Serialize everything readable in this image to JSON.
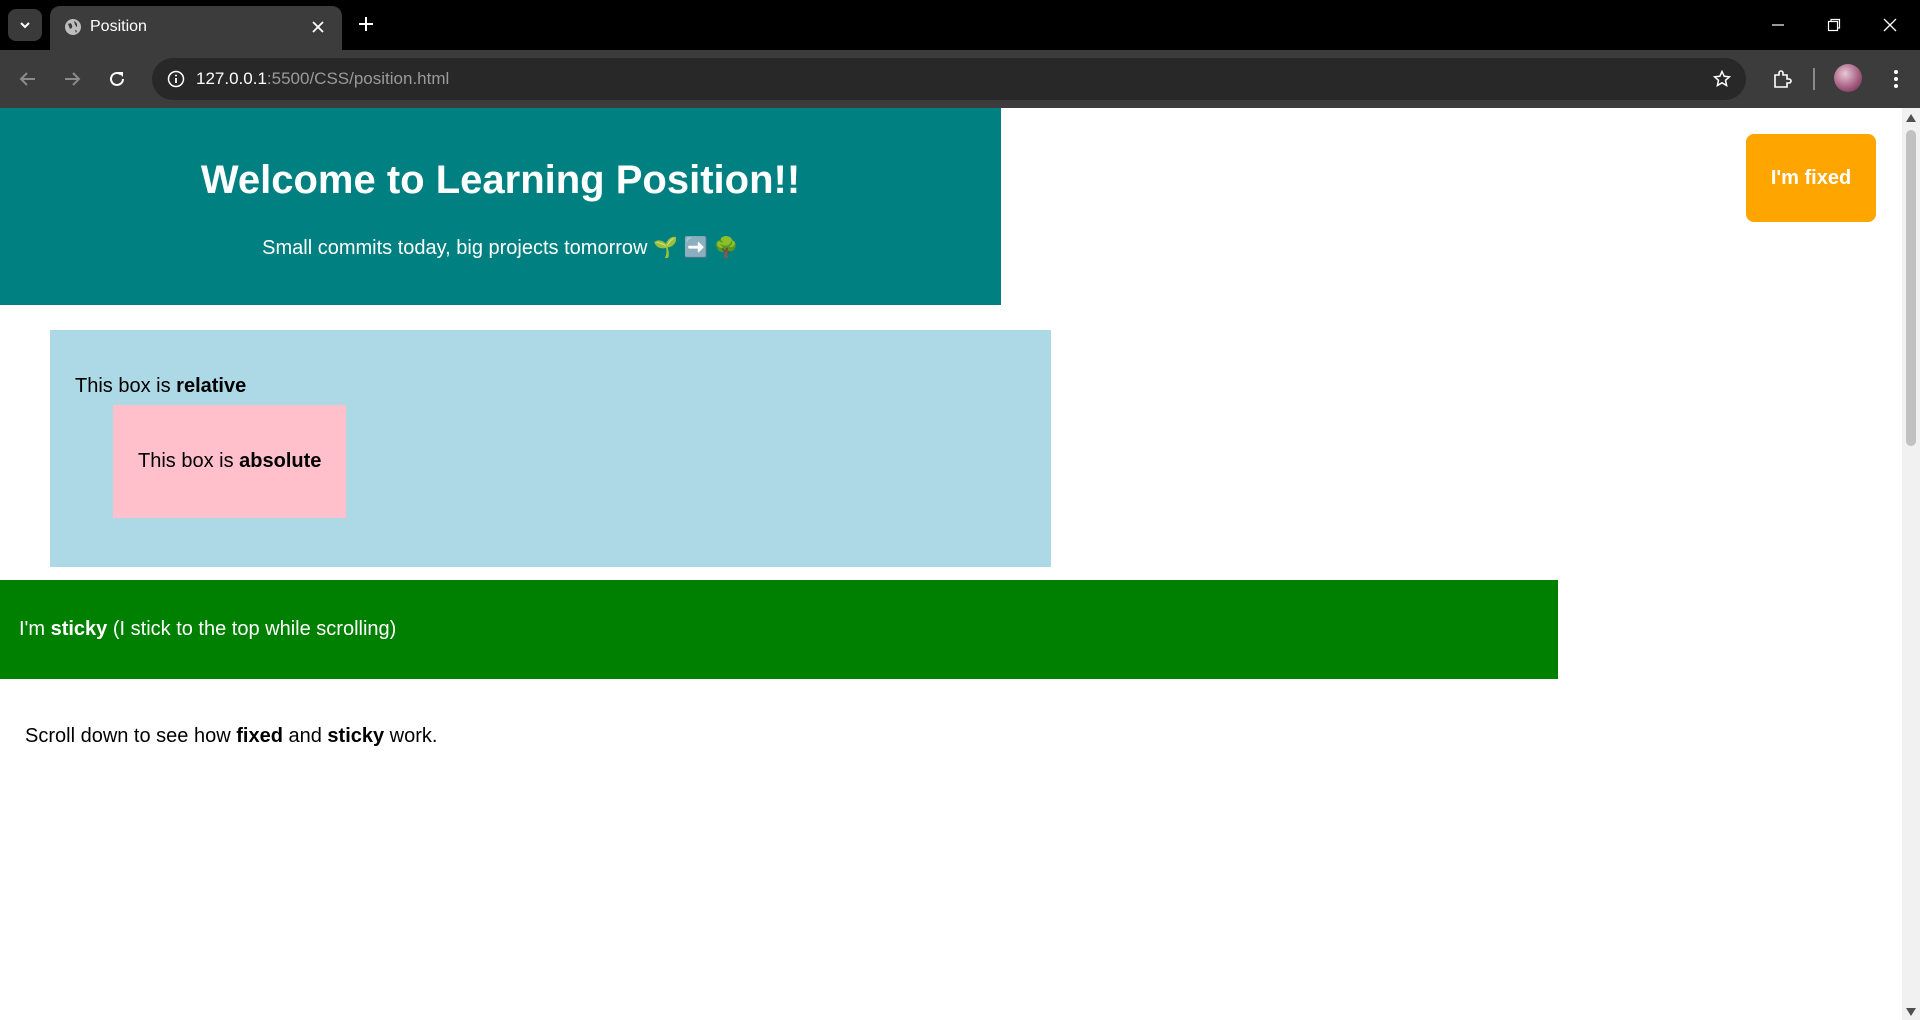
{
  "browser": {
    "tab_title": "Position",
    "url_host": "127.0.0.1",
    "url_rest": ":5500/CSS/position.html"
  },
  "page": {
    "hero": {
      "title": "Welcome to Learning Position!!",
      "subtitle": "Small commits today, big projects tomorrow 🌱 ➡️ 🌳"
    },
    "relative_box": {
      "prefix": "This box is ",
      "bold": "relative"
    },
    "absolute_box": {
      "prefix": "This box is ",
      "bold": "absolute"
    },
    "sticky": {
      "prefix": "I'm ",
      "bold": "sticky",
      "suffix": " (I stick to the top while scrolling)"
    },
    "note": {
      "part1": "Scroll down to see how ",
      "bold1": "fixed",
      "part2": " and ",
      "bold2": "sticky",
      "part3": " work."
    },
    "fixed_label": "I'm fixed"
  },
  "colors": {
    "hero_bg": "#008080",
    "relative_bg": "#add8e6",
    "absolute_bg": "#ffc0cb",
    "sticky_bg": "#008000",
    "fixed_bg": "#ffa500"
  }
}
